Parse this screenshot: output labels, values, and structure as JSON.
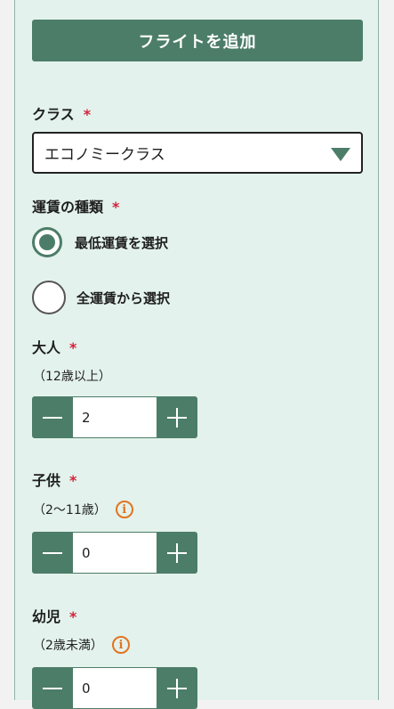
{
  "add_flight_button": "フライトを追加",
  "class_field": {
    "label": "クラス",
    "required_mark": "*",
    "selected": "エコノミークラス"
  },
  "fare_type": {
    "label": "運賃の種類",
    "required_mark": "*",
    "options": [
      {
        "label": "最低運賃を選択",
        "checked": true
      },
      {
        "label": "全運賃から選択",
        "checked": false
      }
    ]
  },
  "adults": {
    "label": "大人",
    "required_mark": "*",
    "sub": "（12歳以上）",
    "value": "2"
  },
  "children": {
    "label": "子供",
    "required_mark": "*",
    "sub": "（2〜11歳）",
    "value": "0"
  },
  "infants": {
    "label": "幼児",
    "required_mark": "*",
    "sub": "（2歳未満）",
    "value": "0"
  },
  "info_icon_glyph": "i",
  "colors": {
    "accent": "#4c7d68",
    "panel_bg": "#e3f2ec",
    "required": "#d2233c",
    "info": "#e27420"
  }
}
